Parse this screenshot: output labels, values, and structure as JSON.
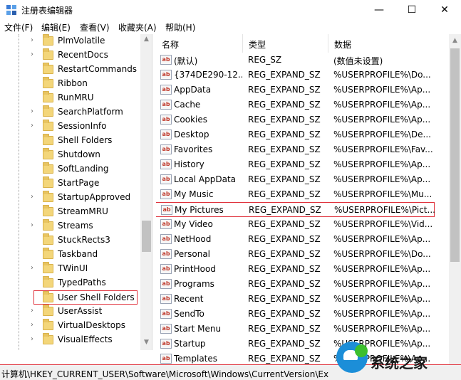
{
  "window": {
    "title": "注册表编辑器",
    "minimize_glyph": "—",
    "maximize_glyph": "☐",
    "close_glyph": "✕"
  },
  "menu": [
    "文件(F)",
    "编辑(E)",
    "查看(V)",
    "收藏夹(A)",
    "帮助(H)"
  ],
  "tree": {
    "items": [
      {
        "label": "PlmVolatile",
        "expandable": true
      },
      {
        "label": "RecentDocs",
        "expandable": true
      },
      {
        "label": "RestartCommands",
        "expandable": false
      },
      {
        "label": "Ribbon",
        "expandable": false
      },
      {
        "label": "RunMRU",
        "expandable": false
      },
      {
        "label": "SearchPlatform",
        "expandable": true
      },
      {
        "label": "SessionInfo",
        "expandable": true
      },
      {
        "label": "Shell Folders",
        "expandable": false
      },
      {
        "label": "Shutdown",
        "expandable": false
      },
      {
        "label": "SoftLanding",
        "expandable": false
      },
      {
        "label": "StartPage",
        "expandable": false
      },
      {
        "label": "StartupApproved",
        "expandable": true
      },
      {
        "label": "StreamMRU",
        "expandable": false
      },
      {
        "label": "Streams",
        "expandable": true
      },
      {
        "label": "StuckRects3",
        "expandable": false
      },
      {
        "label": "Taskband",
        "expandable": false
      },
      {
        "label": "TWinUI",
        "expandable": true
      },
      {
        "label": "TypedPaths",
        "expandable": false
      },
      {
        "label": "User Shell Folders",
        "expandable": false,
        "selected": true
      },
      {
        "label": "UserAssist",
        "expandable": true
      },
      {
        "label": "VirtualDesktops",
        "expandable": true
      },
      {
        "label": "VisualEffects",
        "expandable": true
      }
    ]
  },
  "list": {
    "columns": [
      "名称",
      "类型",
      "数据"
    ],
    "rows": [
      {
        "name": "(默认)",
        "type": "REG_SZ",
        "data": "(数值未设置)"
      },
      {
        "name": "{374DE290-12...",
        "type": "REG_EXPAND_SZ",
        "data": "%USERPROFILE%\\Do..."
      },
      {
        "name": "AppData",
        "type": "REG_EXPAND_SZ",
        "data": "%USERPROFILE%\\Ap..."
      },
      {
        "name": "Cache",
        "type": "REG_EXPAND_SZ",
        "data": "%USERPROFILE%\\Ap..."
      },
      {
        "name": "Cookies",
        "type": "REG_EXPAND_SZ",
        "data": "%USERPROFILE%\\Ap..."
      },
      {
        "name": "Desktop",
        "type": "REG_EXPAND_SZ",
        "data": "%USERPROFILE%\\De..."
      },
      {
        "name": "Favorites",
        "type": "REG_EXPAND_SZ",
        "data": "%USERPROFILE%\\Fav..."
      },
      {
        "name": "History",
        "type": "REG_EXPAND_SZ",
        "data": "%USERPROFILE%\\Ap..."
      },
      {
        "name": "Local AppData",
        "type": "REG_EXPAND_SZ",
        "data": "%USERPROFILE%\\Ap..."
      },
      {
        "name": "My Music",
        "type": "REG_EXPAND_SZ",
        "data": "%USERPROFILE%\\Mu..."
      },
      {
        "name": "My Pictures",
        "type": "REG_EXPAND_SZ",
        "data": "%USERPROFILE%\\Pict...",
        "selected": true
      },
      {
        "name": "My Video",
        "type": "REG_EXPAND_SZ",
        "data": "%USERPROFILE%\\Vid..."
      },
      {
        "name": "NetHood",
        "type": "REG_EXPAND_SZ",
        "data": "%USERPROFILE%\\Ap..."
      },
      {
        "name": "Personal",
        "type": "REG_EXPAND_SZ",
        "data": "%USERPROFILE%\\Do..."
      },
      {
        "name": "PrintHood",
        "type": "REG_EXPAND_SZ",
        "data": "%USERPROFILE%\\Ap..."
      },
      {
        "name": "Programs",
        "type": "REG_EXPAND_SZ",
        "data": "%USERPROFILE%\\Ap..."
      },
      {
        "name": "Recent",
        "type": "REG_EXPAND_SZ",
        "data": "%USERPROFILE%\\Ap..."
      },
      {
        "name": "SendTo",
        "type": "REG_EXPAND_SZ",
        "data": "%USERPROFILE%\\Ap..."
      },
      {
        "name": "Start Menu",
        "type": "REG_EXPAND_SZ",
        "data": "%USERPROFILE%\\Ap..."
      },
      {
        "name": "Startup",
        "type": "REG_EXPAND_SZ",
        "data": "%USERPROFILE%\\Ap..."
      },
      {
        "name": "Templates",
        "type": "REG_EXPAND_SZ",
        "data": "%USERPROFILE%\\Ap..."
      }
    ]
  },
  "status": {
    "path": "计算机\\HKEY_CURRENT_USER\\Software\\Microsoft\\Windows\\CurrentVersion\\Ex"
  },
  "watermark": {
    "text": "系统之家"
  },
  "colors": {
    "highlight_border": "#e0323c",
    "folder": "#f3d67a",
    "watermark_blue": "#1c8ed8"
  }
}
